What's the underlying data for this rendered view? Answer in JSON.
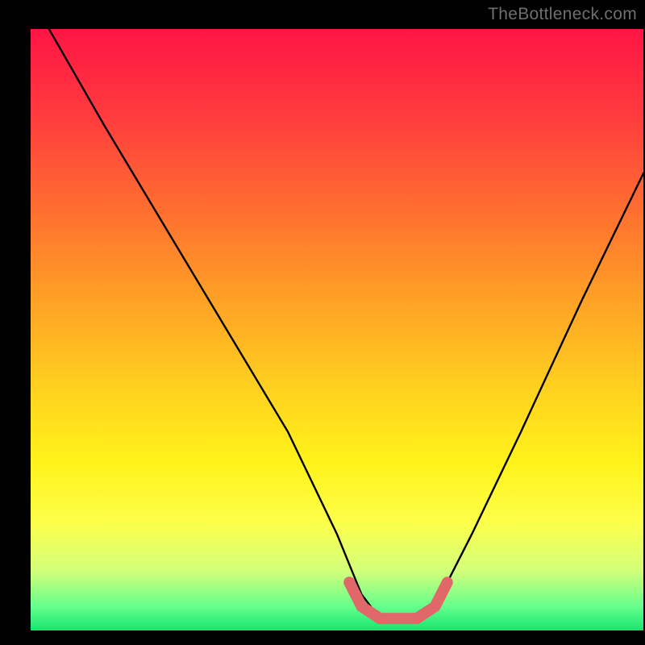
{
  "watermark": "TheBottleneck.com",
  "chart_data": {
    "type": "line",
    "title": "",
    "xlabel": "",
    "ylabel": "",
    "xlim": [
      0,
      100
    ],
    "ylim": [
      0,
      100
    ],
    "series": [
      {
        "name": "bottleneck-curve",
        "x": [
          3,
          12,
          22,
          32,
          42,
          50,
          54,
          57,
          60,
          64,
          67,
          72,
          80,
          90,
          100
        ],
        "values": [
          100,
          84,
          67,
          50,
          33,
          16,
          6,
          2,
          2,
          2,
          6,
          16,
          33,
          55,
          76
        ]
      }
    ],
    "marker_segment": {
      "name": "optimal-range",
      "x": [
        52,
        54,
        57,
        60,
        63,
        66,
        68
      ],
      "values": [
        8,
        4,
        2,
        2,
        2,
        4,
        8
      ]
    },
    "gradient_stops": [
      {
        "pos": 0.0,
        "color": "#ff1545"
      },
      {
        "pos": 0.14,
        "color": "#ff3a3e"
      },
      {
        "pos": 0.3,
        "color": "#ff6e30"
      },
      {
        "pos": 0.45,
        "color": "#ffa126"
      },
      {
        "pos": 0.6,
        "color": "#ffd21f"
      },
      {
        "pos": 0.72,
        "color": "#fff21a"
      },
      {
        "pos": 0.82,
        "color": "#fdff4a"
      },
      {
        "pos": 0.9,
        "color": "#d4ff7a"
      },
      {
        "pos": 0.96,
        "color": "#66ff8c"
      },
      {
        "pos": 1.0,
        "color": "#17e56f"
      }
    ]
  }
}
